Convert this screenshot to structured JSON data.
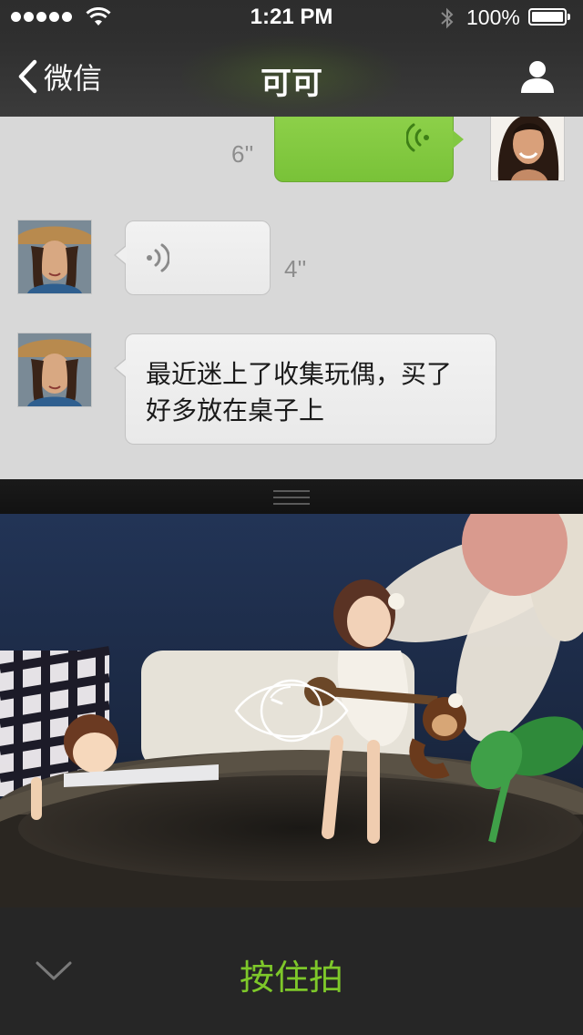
{
  "status_bar": {
    "time": "1:21 PM",
    "battery": "100%"
  },
  "nav": {
    "back_label": "微信",
    "title": "可可"
  },
  "messages": [
    {
      "side": "right",
      "type": "voice",
      "duration": "6''"
    },
    {
      "side": "left",
      "type": "voice",
      "duration": "4''"
    },
    {
      "side": "left",
      "type": "text",
      "text": "最近迷上了收集玩偶，买了好多放在桌子上"
    }
  ],
  "camera": {
    "shoot_label": "按住拍"
  },
  "colors": {
    "accent_green": "#7ec82a",
    "bubble_green": "#82c842"
  },
  "icons": {
    "back": "chevron-left-icon",
    "profile": "person-icon",
    "voice": "sound-wave-icon",
    "eye": "eye-icon",
    "collapse": "chevron-down-icon"
  }
}
